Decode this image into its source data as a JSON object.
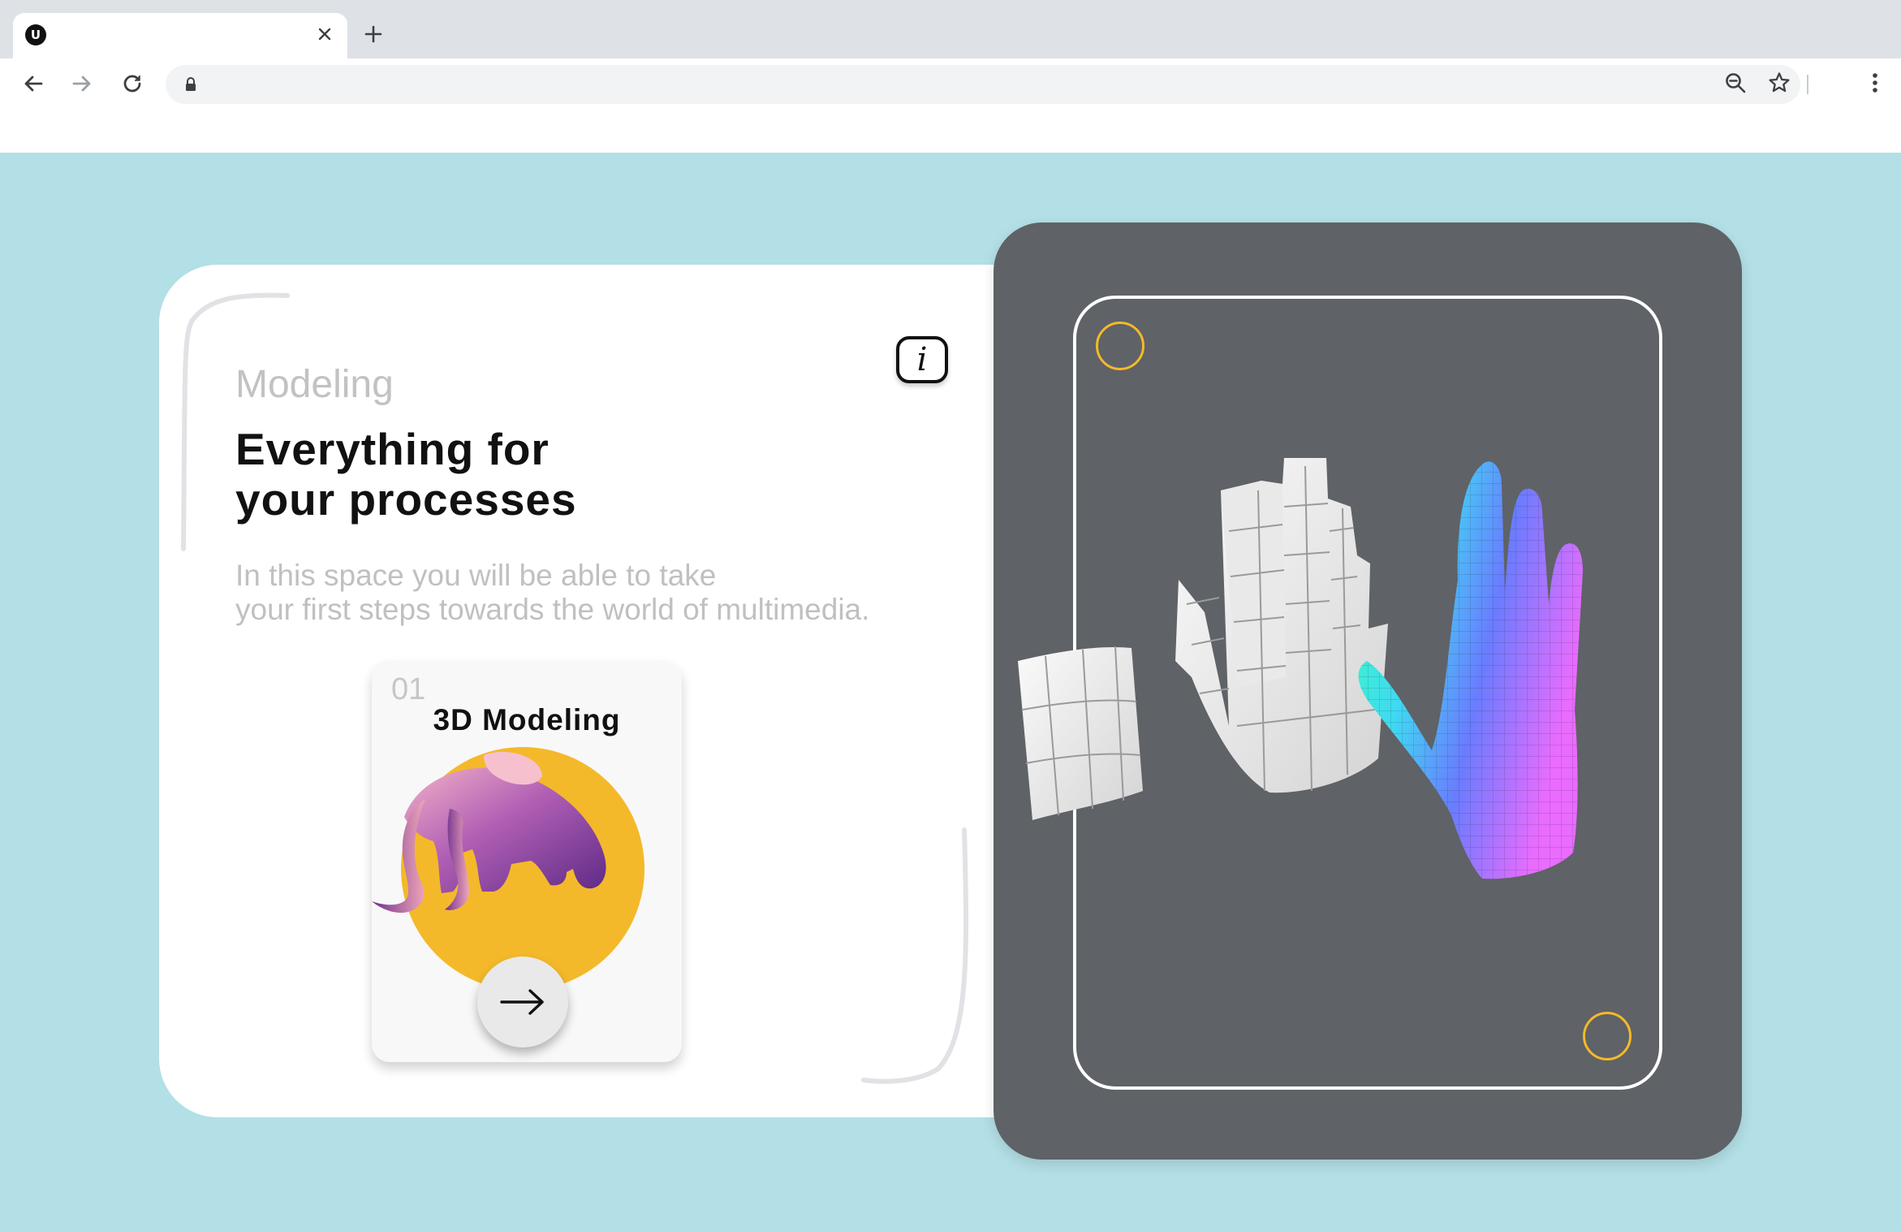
{
  "browser": {
    "tab": {
      "favicon_letter": "U",
      "title": "",
      "close_glyph": "×"
    },
    "new_tab_glyph": "+",
    "omnibox": {
      "url": ""
    }
  },
  "content": {
    "eyebrow": "Modeling",
    "headline_lines": [
      "Everything for",
      "your processes"
    ],
    "description_lines": [
      "In this space you will be able to take",
      "your first steps towards the world of multimedia."
    ],
    "topic_card": {
      "number": "01",
      "title": "3D Modeling"
    }
  },
  "colors": {
    "page_background": "#b3dfe6",
    "dark_panel": "#5f6266",
    "accent_yellow": "#f4b92a",
    "mammoth_purple": "#8a3aa0"
  },
  "icons": {
    "back": "arrow-left-icon",
    "forward": "arrow-right-icon",
    "reload": "reload-icon",
    "lock": "lock-icon",
    "zoom": "zoom-out-icon",
    "bookmark": "star-icon",
    "menu": "kebab-menu-icon",
    "info": "info-icon",
    "next": "arrow-right-icon"
  }
}
